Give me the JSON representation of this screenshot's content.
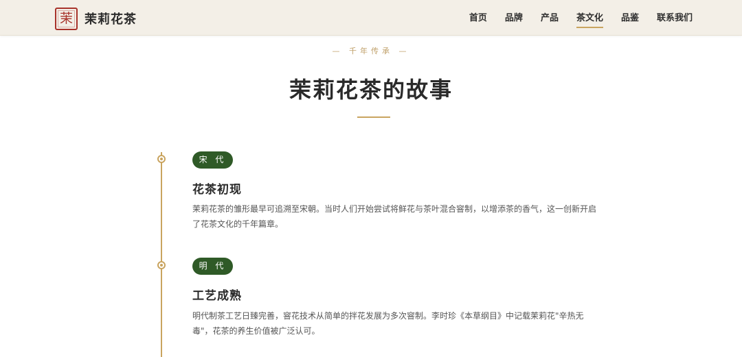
{
  "header": {
    "logo_seal": "茉",
    "logo_name": "茉莉花茶",
    "nav": [
      {
        "label": "首页",
        "active": false
      },
      {
        "label": "品牌",
        "active": false
      },
      {
        "label": "产品",
        "active": false
      },
      {
        "label": "茶文化",
        "active": true
      },
      {
        "label": "品鉴",
        "active": false
      },
      {
        "label": "联系我们",
        "active": false
      }
    ]
  },
  "section": {
    "kicker": "— 千年传承 —",
    "title": "茉莉花茶的故事"
  },
  "timeline": [
    {
      "era": "宋 代",
      "title": "花茶初现",
      "desc": "茉莉花茶的雏形最早可追溯至宋朝。当时人们开始尝试将鲜花与茶叶混合窨制，以增添茶的香气，这一创新开启了花茶文化的千年篇章。"
    },
    {
      "era": "明 代",
      "title": "工艺成熟",
      "desc": "明代制茶工艺日臻完善，窨花技术从简单的拌花发展为多次窨制。李时珍《本草纲目》中记载茉莉花\"辛热无毒\"，花茶的养生价值被广泛认可。"
    }
  ],
  "colors": {
    "accent_gold": "#c9a45f",
    "badge_green": "#2f5a27",
    "seal_red": "#a8322a",
    "header_bg": "#f3efe7"
  }
}
